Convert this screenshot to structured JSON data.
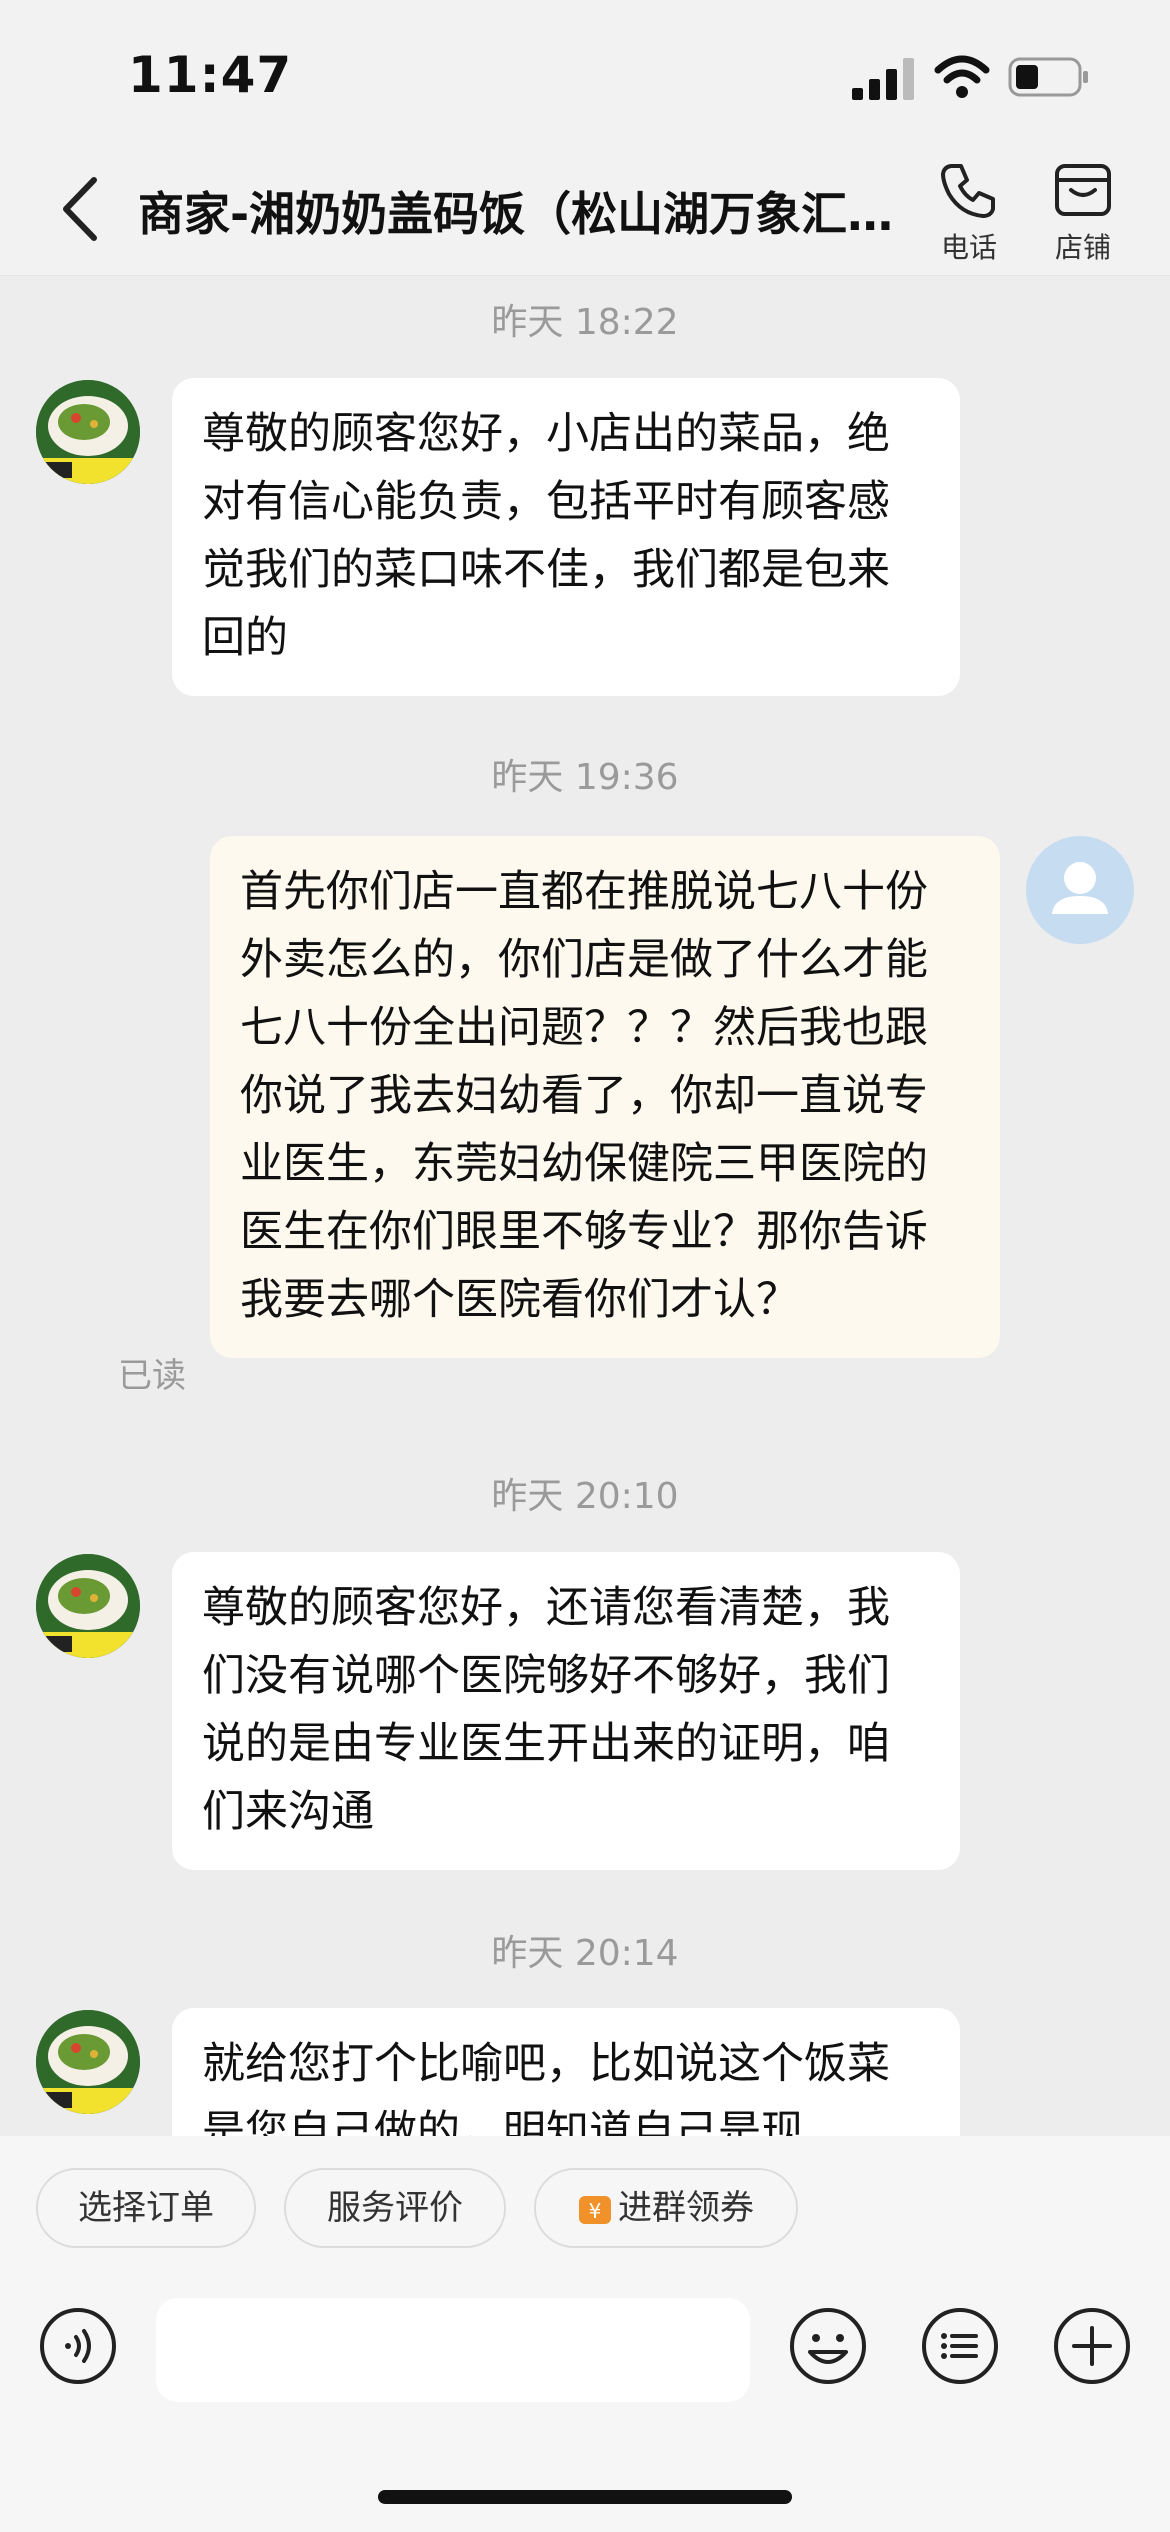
{
  "status_bar": {
    "time": "11:47",
    "signal_icon": "signal-icon",
    "wifi_icon": "wifi-icon",
    "battery_icon": "battery-icon"
  },
  "header": {
    "title": "商家-湘奶奶盖码饭（松山湖万象汇…",
    "phone_label": "电话",
    "store_label": "店铺"
  },
  "messages": [
    {
      "type": "timestamp",
      "text": "昨天 18:22"
    },
    {
      "type": "incoming",
      "sender": "merchant",
      "text": "尊敬的顾客您好，小店出的菜品，绝对有信心能负责，包括平时有顾客感觉我们的菜口味不佳，我们都是包来回的"
    },
    {
      "type": "timestamp",
      "text": "昨天 19:36"
    },
    {
      "type": "outgoing",
      "sender": "me",
      "status": "已读",
      "text": "首先你们店一直都在推脱说七八十份外卖怎么的，你们店是做了什么才能七八十份全出问题？？？然后我也跟你说了我去妇幼看了，你却一直说专业医生，东莞妇幼保健院三甲医院的医生在你们眼里不够专业？那你告诉我要去哪个医院看你们才认？"
    },
    {
      "type": "timestamp",
      "text": "昨天 20:10"
    },
    {
      "type": "incoming",
      "sender": "merchant",
      "text": "尊敬的顾客您好，还请您看清楚，我们没有说哪个医院够好不够好，我们说的是由专业医生开出来的证明，咱们来沟通"
    },
    {
      "type": "timestamp",
      "text": "昨天 20:14"
    },
    {
      "type": "incoming",
      "sender": "merchant",
      "text": "就给您打个比喻吧，比如说这个饭菜是您自己做的，明知道自己是现"
    }
  ],
  "quick_actions": [
    {
      "label": "选择订单"
    },
    {
      "label": "服务评价"
    },
    {
      "label": "进群领券",
      "icon": "coupon-icon"
    }
  ],
  "input_bar": {
    "voice_icon": "voice-icon",
    "emoji_icon": "emoji-icon",
    "menu_icon": "list-icon",
    "plus_icon": "plus-icon"
  },
  "colors": {
    "background": "#ededed",
    "incoming_bubble": "#ffffff",
    "outgoing_bubble": "#fdf9ef",
    "user_avatar": "#c6dcf1",
    "muted_text": "#9a9a9a"
  }
}
